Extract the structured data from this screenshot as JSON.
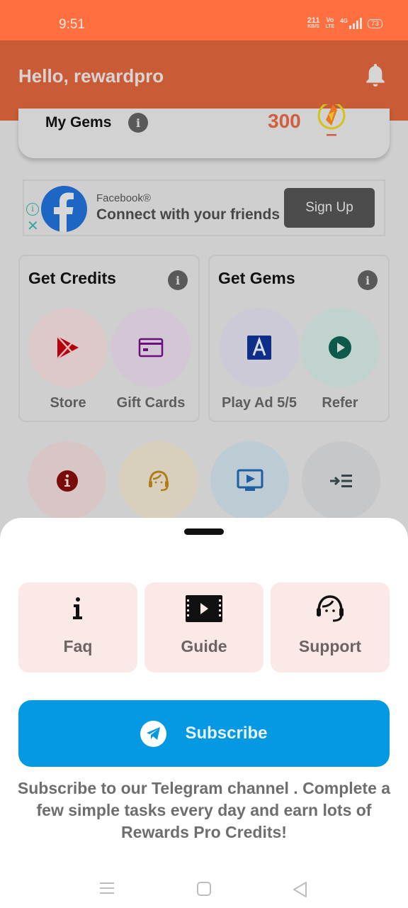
{
  "status_bar": {
    "time": "9:51",
    "net_speed_value": "211",
    "net_speed_unit": "KB/S",
    "volte_top": "Vo",
    "volte_bottom": "LTE",
    "network": "4G",
    "battery": "73"
  },
  "header": {
    "greeting": "Hello, rewardpro",
    "notification_icon": "bell-icon"
  },
  "gems_card": {
    "label": "My Gems",
    "info_glyph": "i",
    "value": "300",
    "icon": "gem-icon"
  },
  "ad": {
    "info_glyph": "i",
    "close_glyph": "✕",
    "brand": "Facebook®",
    "headline": "Connect with your friends",
    "cta": "Sign Up"
  },
  "get_credits": {
    "title": "Get Credits",
    "info_glyph": "i",
    "items": [
      {
        "label": "Store",
        "icon": "play-store-icon",
        "bg": "#dccaca",
        "color": "#b3000c"
      },
      {
        "label": "Gift Cards",
        "icon": "credit-card-icon",
        "bg": "#d3c7d6",
        "color": "#6b0f7a"
      }
    ]
  },
  "get_gems": {
    "title": "Get Gems",
    "info_glyph": "i",
    "items": [
      {
        "label": "Play Ad 5/5",
        "icon": "ad-icon",
        "bg": "#cbcad6",
        "color": "#0d2f8a"
      },
      {
        "label": "Refer",
        "icon": "play-circle-icon",
        "bg": "#c2d2cf",
        "color": "#0d5a4a"
      }
    ]
  },
  "quick_actions": [
    {
      "name": "faq",
      "icon": "info-icon",
      "bg": "#d8c5c6",
      "color": "#7a0b0b"
    },
    {
      "name": "support",
      "icon": "headset-icon",
      "bg": "#d8d0bd",
      "color": "#b07c15"
    },
    {
      "name": "guide",
      "icon": "tv-play-icon",
      "bg": "#bccbd4",
      "color": "#1d5ea6"
    },
    {
      "name": "more",
      "icon": "indent-icon",
      "bg": "#c5c7c8",
      "color": "#34454a"
    }
  ],
  "sheet": {
    "tiles": [
      {
        "label": "Faq",
        "icon": "info-icon"
      },
      {
        "label": "Guide",
        "icon": "video-icon"
      },
      {
        "label": "Support",
        "icon": "headset-icon"
      }
    ],
    "subscribe_label": "Subscribe",
    "subscribe_icon": "telegram-icon",
    "description": "Subscribe to our Telegram channel . Complete a few simple tasks every day and earn lots of Rewards Pro Credits!"
  },
  "colors": {
    "status_bar": "#ff6f3f",
    "header": "#c95b36",
    "accent_value": "#cf5f3f",
    "subscribe_button": "#0598e3",
    "tile_bg": "#fbe9e7"
  }
}
